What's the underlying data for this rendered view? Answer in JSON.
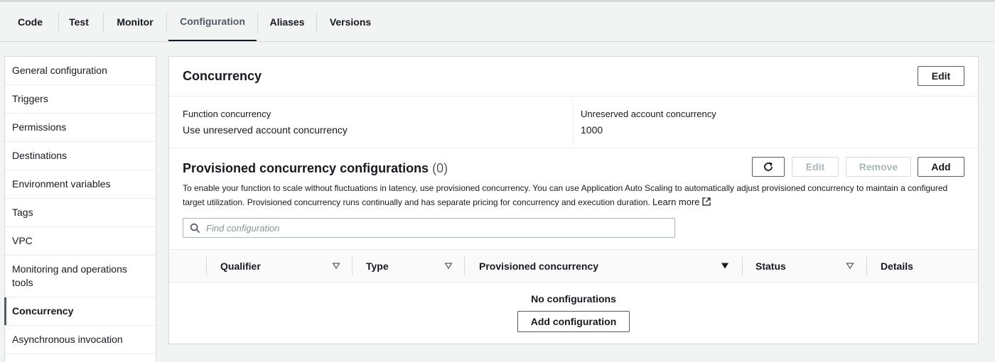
{
  "tabs": [
    {
      "label": "Code"
    },
    {
      "label": "Test"
    },
    {
      "label": "Monitor"
    },
    {
      "label": "Configuration",
      "active": true
    },
    {
      "label": "Aliases"
    },
    {
      "label": "Versions"
    }
  ],
  "sidebar": {
    "items": [
      {
        "label": "General configuration"
      },
      {
        "label": "Triggers"
      },
      {
        "label": "Permissions"
      },
      {
        "label": "Destinations"
      },
      {
        "label": "Environment variables"
      },
      {
        "label": "Tags"
      },
      {
        "label": "VPC"
      },
      {
        "label": "Monitoring and operations tools"
      },
      {
        "label": "Concurrency",
        "active": true
      },
      {
        "label": "Asynchronous invocation"
      }
    ]
  },
  "concurrency": {
    "title": "Concurrency",
    "edit_label": "Edit",
    "function_concurrency_label": "Function concurrency",
    "function_concurrency_value": "Use unreserved account concurrency",
    "unreserved_label": "Unreserved account concurrency",
    "unreserved_value": "1000"
  },
  "provisioned": {
    "title": "Provisioned concurrency configurations",
    "count": "(0)",
    "refresh_icon": "refresh-icon",
    "edit_label": "Edit",
    "remove_label": "Remove",
    "add_label": "Add",
    "description": "To enable your function to scale without fluctuations in latency, use provisioned concurrency. You can use Application Auto Scaling to automatically adjust provisioned concurrency to maintain a configured target utilization. Provisioned concurrency runs continually and has separate pricing for concurrency and execution duration.",
    "learn_more": "Learn more",
    "search_placeholder": "Find configuration",
    "columns": [
      {
        "label": "Qualifier"
      },
      {
        "label": "Type"
      },
      {
        "label": "Provisioned concurrency"
      },
      {
        "label": "Status"
      },
      {
        "label": "Details"
      }
    ],
    "sorted_column": "Provisioned concurrency",
    "empty_text": "No configurations",
    "add_config_label": "Add configuration"
  },
  "colors": {
    "background": "#f2f3f3",
    "border": "#d5dbdb",
    "text": "#16191f",
    "disabled": "#aab7b8"
  }
}
